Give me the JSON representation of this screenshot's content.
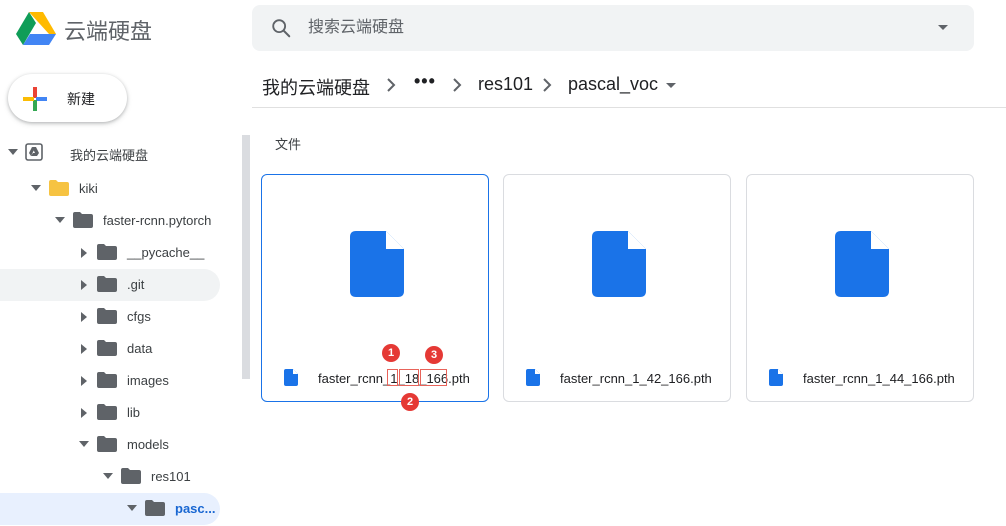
{
  "app": {
    "title": "云端硬盘"
  },
  "search": {
    "placeholder": "搜索云端硬盘"
  },
  "new_button": {
    "label": "新建"
  },
  "sidebar": {
    "tree": [
      {
        "label": "我的云端硬盘",
        "expanded": true
      },
      {
        "label": "kiki",
        "expanded": true,
        "color": "#f6c342"
      },
      {
        "label": "faster-rcnn.pytorch",
        "expanded": true
      },
      {
        "label": "__pycache__",
        "expanded": false
      },
      {
        "label": ".git",
        "expanded": false
      },
      {
        "label": "cfgs",
        "expanded": false
      },
      {
        "label": "data",
        "expanded": false
      },
      {
        "label": "images",
        "expanded": false
      },
      {
        "label": "lib",
        "expanded": false
      },
      {
        "label": "models",
        "expanded": true
      },
      {
        "label": "res101",
        "expanded": true
      },
      {
        "label": "pasc...",
        "expanded": true,
        "selected": true
      }
    ]
  },
  "breadcrumb": {
    "root": "我的云端硬盘",
    "more": "•••",
    "items": [
      "res101",
      "pascal_voc"
    ]
  },
  "section": {
    "title": "文件"
  },
  "files": [
    {
      "name": "faster_rcnn_1_18_166.pth",
      "name_parts": [
        "faster_rcnn_",
        "1",
        "_",
        "18",
        "_",
        "166",
        ".pth"
      ],
      "selected": true
    },
    {
      "name": "faster_rcnn_1_42_166.pth"
    },
    {
      "name": "faster_rcnn_1_44_166.pth"
    }
  ],
  "annotations": [
    {
      "number": "1"
    },
    {
      "number": "2"
    },
    {
      "number": "3"
    }
  ],
  "colors": {
    "accent": "#1a73e8",
    "file_icon": "#1a73e8",
    "folder": "#5f6368",
    "annotation": "#e53935"
  }
}
